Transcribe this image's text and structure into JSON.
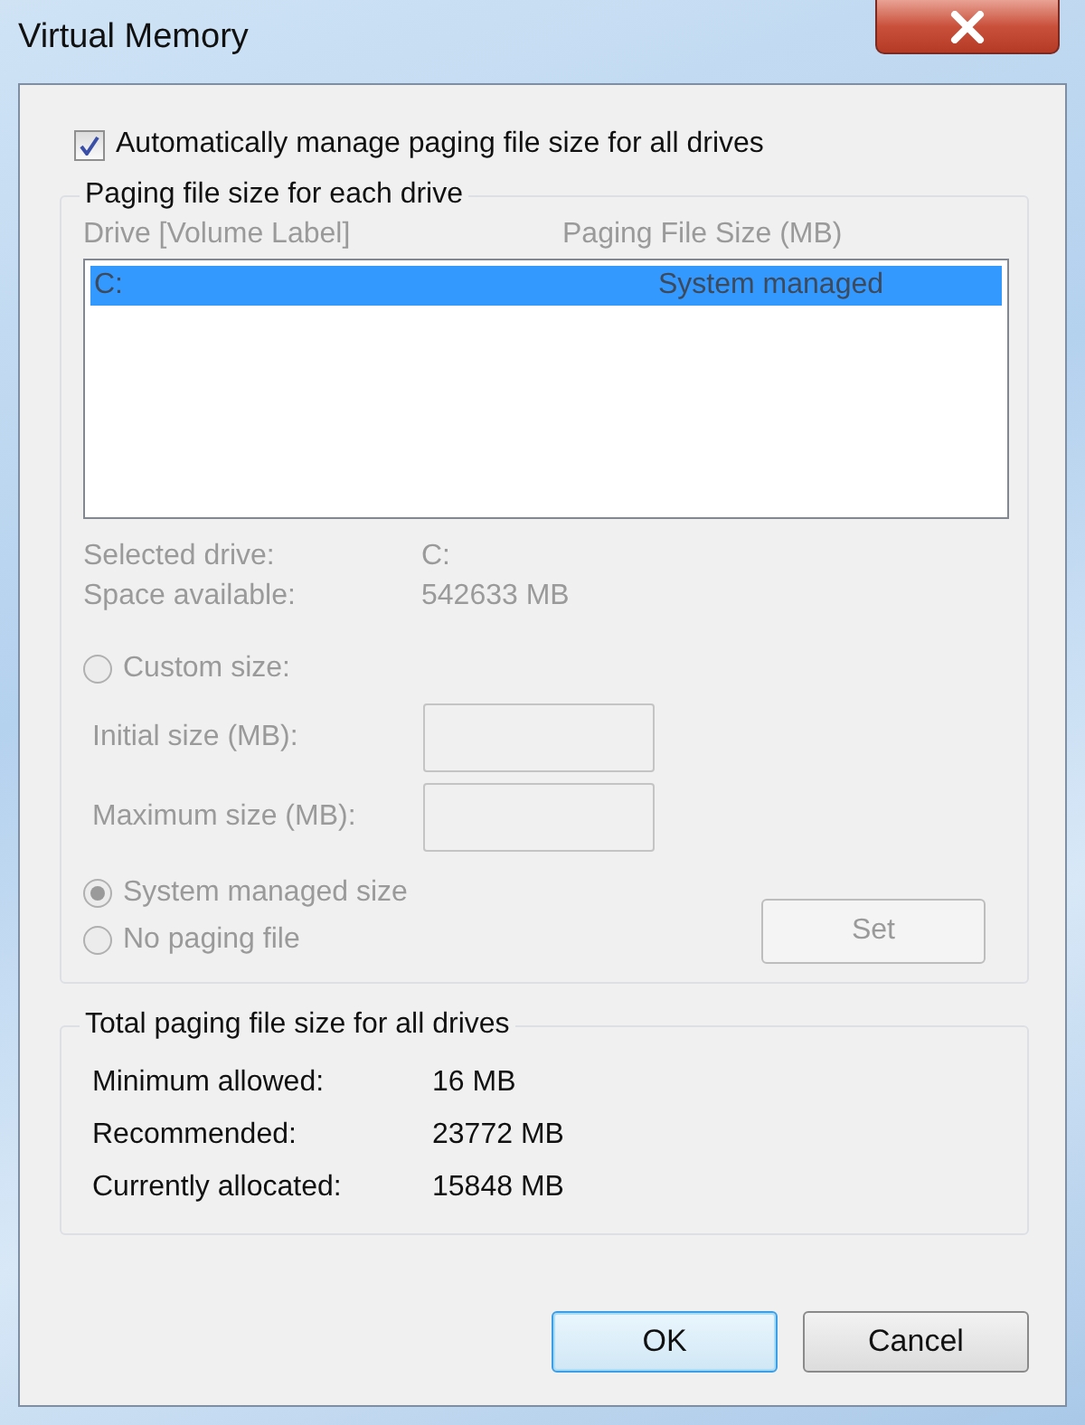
{
  "window": {
    "title": "Virtual Memory"
  },
  "auto_manage": {
    "label": "Automatically manage paging file size for all drives",
    "checked": true
  },
  "drive_group": {
    "title": "Paging file size for each drive",
    "disabled": true,
    "columns": [
      "Drive  [Volume Label]",
      "Paging File Size (MB)"
    ],
    "drives": [
      {
        "drive": "C:",
        "size": "System managed",
        "selected": true
      }
    ],
    "details": [
      {
        "label": "Selected drive:",
        "value": "C:"
      },
      {
        "label": "Space available:",
        "value": "542633 MB"
      }
    ],
    "size_options": [
      {
        "label": "Custom size:",
        "selected": false,
        "fields": [
          {
            "label": "Initial size (MB):"
          },
          {
            "label": "Maximum size (MB):"
          }
        ]
      },
      {
        "label": "System managed size",
        "selected": true
      },
      {
        "label": "No paging file",
        "selected": false
      }
    ],
    "set_button": "Set"
  },
  "total_group": {
    "title": "Total paging file size for all drives",
    "rows": [
      {
        "label": "Minimum allowed:",
        "value": "16 MB"
      },
      {
        "label": "Recommended:",
        "value": "23772 MB"
      },
      {
        "label": "Currently allocated:",
        "value": "15848 MB"
      }
    ]
  },
  "buttons": [
    {
      "label": "OK",
      "default": true
    },
    {
      "label": "Cancel",
      "default": false
    }
  ]
}
